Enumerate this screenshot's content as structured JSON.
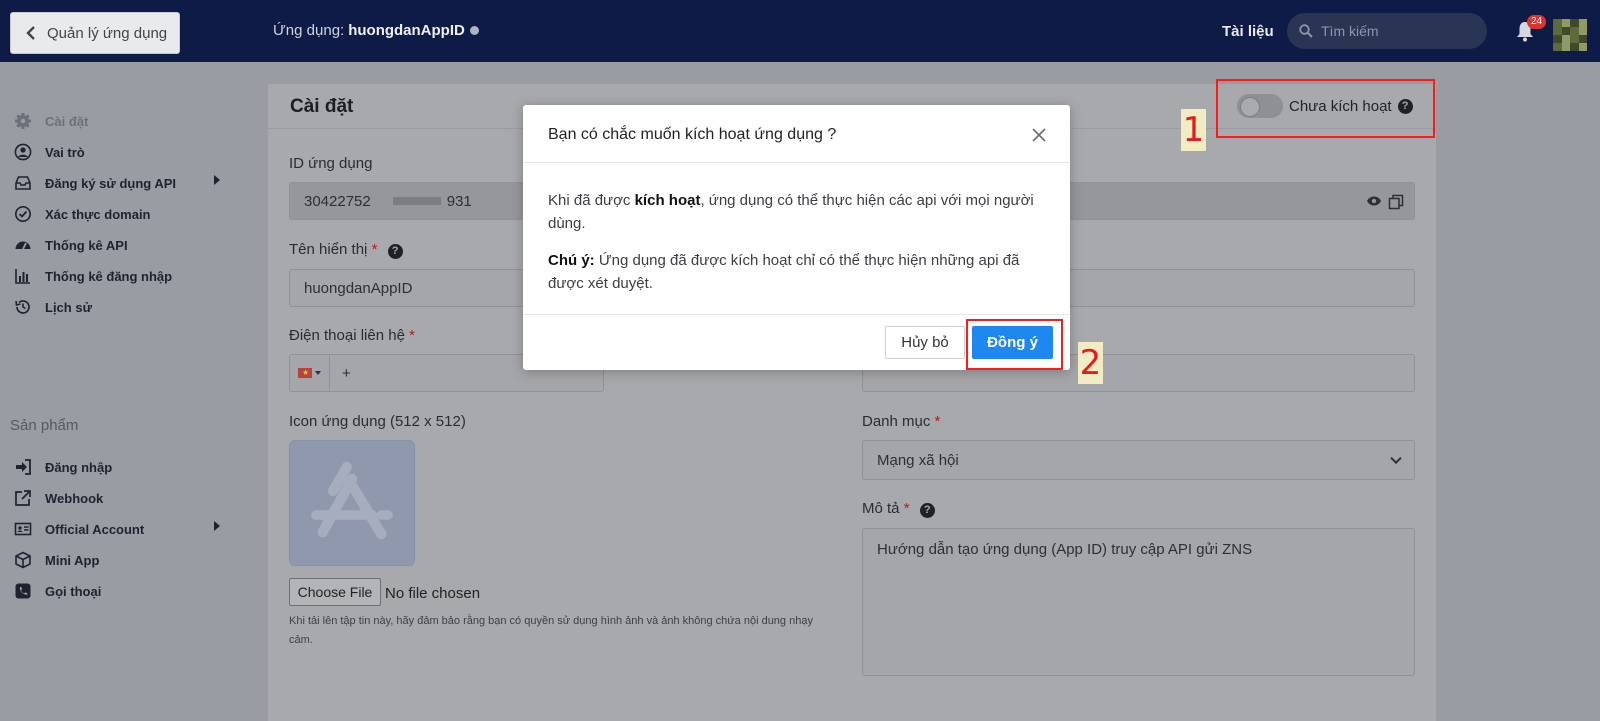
{
  "header": {
    "back_label": "Quản lý ứng dụng",
    "app_prefix": "Ứng dụng:",
    "app_name": "huongdanAppID",
    "docs_label": "Tài liệu",
    "search_placeholder": "Tìm kiếm",
    "notification_count": "24"
  },
  "sidebar": {
    "items": [
      {
        "label": "Cài đặt",
        "icon": "gear-icon"
      },
      {
        "label": "Vai trò",
        "icon": "user-icon"
      },
      {
        "label": "Đăng ký sử dụng API",
        "icon": "inbox-icon"
      },
      {
        "label": "Xác thực domain",
        "icon": "check-circle-icon"
      },
      {
        "label": "Thống kê API",
        "icon": "gauge-icon"
      },
      {
        "label": "Thống kê đăng nhập",
        "icon": "bar-chart-icon"
      },
      {
        "label": "Lịch sử",
        "icon": "history-icon"
      }
    ],
    "section_title": "Sản phẩm",
    "products": [
      {
        "label": "Đăng nhập",
        "icon": "sign-in-icon"
      },
      {
        "label": "Webhook",
        "icon": "external-link-icon"
      },
      {
        "label": "Official Account",
        "icon": "id-card-icon"
      },
      {
        "label": "Mini App",
        "icon": "cube-icon"
      },
      {
        "label": "Gọi thoại",
        "icon": "phone-icon"
      }
    ]
  },
  "main": {
    "title": "Cài đặt",
    "status_label": "Chưa kích hoạt",
    "help_glyph": "?",
    "app_id_label": "ID ứng dụng",
    "app_id_start": "30422752",
    "app_id_end": "931",
    "display_name_label": "Tên hiển thị",
    "display_name_value": "huongdanAppID",
    "phone_label": "Điện thoại liên hệ",
    "phone_prefix": "+",
    "icon_label": "Icon ứng dụng (512 x 512)",
    "choose_file": "Choose File",
    "no_file": "No file chosen",
    "upload_note": "Khi tải lên tập tin này, hãy đảm bảo rằng bạn có quyền sử dụng hình ảnh và ảnh không chứa nội dung nhạy cảm.",
    "category_label": "Danh mục",
    "category_value": "Mạng xã hội",
    "description_label": "Mô tả",
    "description_value": "Hướng dẫn tạo ứng dụng (App ID) truy cập API gửi ZNS",
    "required_mark": "*"
  },
  "annotations": {
    "step1": "1",
    "step2": "2",
    "highlight_color": "#ff1a1a"
  },
  "modal": {
    "title": "Bạn có chắc muốn kích hoạt ứng dụng ?",
    "line1_pre": "Khi đã được ",
    "line1_bold": "kích hoạt",
    "line1_post": ", ứng dụng có thể thực hiện các api với mọi người dùng.",
    "note_bold": "Chú ý:",
    "note_text": " Ứng dụng đã được kích hoạt chỉ có thể thực hiện những api đã được xét duyệt.",
    "cancel_label": "Hủy bỏ",
    "ok_label": "Đồng ý",
    "ok_color": "#1e88f0"
  }
}
